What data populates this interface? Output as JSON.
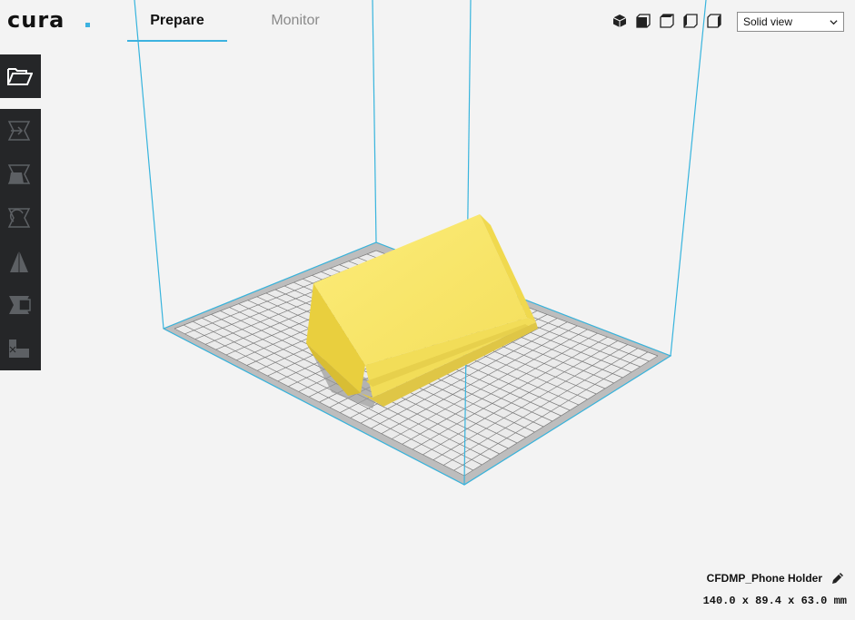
{
  "app": {
    "name": "cura"
  },
  "header": {
    "tabs": [
      {
        "label": "Prepare",
        "active": true
      },
      {
        "label": "Monitor",
        "active": false
      }
    ],
    "view_icons": [
      "3d-view-icon",
      "front-view-icon",
      "top-view-icon",
      "left-view-icon",
      "right-view-icon"
    ],
    "view_mode": {
      "selected": "Solid view"
    }
  },
  "toolbar": {
    "open_icon": "folder-open-icon",
    "tools": [
      "translate-icon",
      "scale-icon",
      "rotate-icon",
      "mirror-icon",
      "per-model-settings-icon",
      "support-blocker-icon"
    ]
  },
  "job": {
    "name": "CFDMP_Phone Holder",
    "dimensions": "140.0 x 89.4 x 63.0 mm"
  },
  "colors": {
    "accent": "#3cb2e0",
    "toolbar_bg": "#252628",
    "model": "#f7e463",
    "build_plate": "#c9c9c9",
    "background": "#f3f3f3"
  }
}
